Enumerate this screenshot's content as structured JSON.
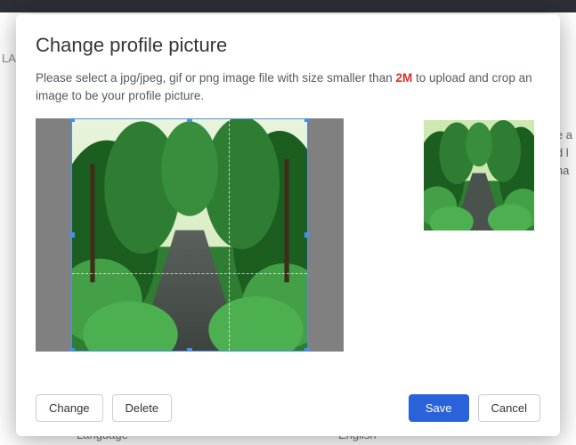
{
  "modal": {
    "title": "Change profile picture",
    "instruction_prefix": "Please select a jpg/jpeg, gif or png image file with size smaller than ",
    "instruction_highlight": "2M",
    "instruction_suffix": " to upload and crop an image to be your profile picture."
  },
  "buttons": {
    "change": "Change",
    "delete": "Delete",
    "save": "Save",
    "cancel": "Cancel"
  },
  "background": {
    "la": "LA",
    "right_line1": "e a",
    "right_line2": "d l",
    "right_line3": "ha",
    "lang_label": "Language",
    "lang_value": "English"
  }
}
